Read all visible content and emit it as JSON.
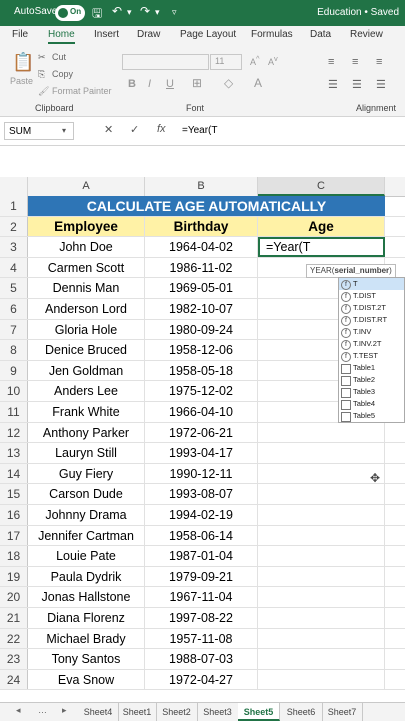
{
  "titlebar": {
    "autosave": "AutoSave",
    "toggle": "On",
    "doc_status": "Education • Saved"
  },
  "tabs": [
    "File",
    "Home",
    "Insert",
    "Draw",
    "Page Layout",
    "Formulas",
    "Data",
    "Review"
  ],
  "ribbon": {
    "paste": "Paste",
    "cut": "Cut",
    "copy": "Copy",
    "format_painter": "Format Painter",
    "clipboard": "Clipboard",
    "font_size": "11",
    "bold": "B",
    "italic": "I",
    "underline": "U",
    "font": "Font",
    "alignment": "Alignment"
  },
  "formula_bar": {
    "name_box": "SUM",
    "cancel": "✕",
    "enter": "✓",
    "fx": "fx",
    "content": "=Year(T"
  },
  "columns": [
    "A",
    "B",
    "C"
  ],
  "title_banner": "CALCULATE AGE AUTOMATICALLY",
  "headers": {
    "employee": "Employee",
    "birthday": "Birthday",
    "age": "Age"
  },
  "active_cell": "=Year(T",
  "rows": [
    {
      "n": "3",
      "name": "John Doe",
      "bday": "1964-04-02"
    },
    {
      "n": "4",
      "name": "Carmen Scott",
      "bday": "1986-11-02"
    },
    {
      "n": "5",
      "name": "Dennis Man",
      "bday": "1969-05-01"
    },
    {
      "n": "6",
      "name": "Anderson Lord",
      "bday": "1982-10-07"
    },
    {
      "n": "7",
      "name": "Gloria Hole",
      "bday": "1980-09-24"
    },
    {
      "n": "8",
      "name": "Denice Bruced",
      "bday": "1958-12-06"
    },
    {
      "n": "9",
      "name": "Jen Goldman",
      "bday": "1958-05-18"
    },
    {
      "n": "10",
      "name": "Anders Lee",
      "bday": "1975-12-02"
    },
    {
      "n": "11",
      "name": "Frank White",
      "bday": "1966-04-10"
    },
    {
      "n": "12",
      "name": "Anthony Parker",
      "bday": "1972-06-21"
    },
    {
      "n": "13",
      "name": "Lauryn Still",
      "bday": "1993-04-17"
    },
    {
      "n": "14",
      "name": "Guy Fiery",
      "bday": "1990-12-11"
    },
    {
      "n": "15",
      "name": "Carson Dude",
      "bday": "1993-08-07"
    },
    {
      "n": "16",
      "name": "Johnny Drama",
      "bday": "1994-02-19"
    },
    {
      "n": "17",
      "name": "Jennifer Cartman",
      "bday": "1958-06-14"
    },
    {
      "n": "18",
      "name": "Louie Pate",
      "bday": "1987-01-04"
    },
    {
      "n": "19",
      "name": "Paula Dydrik",
      "bday": "1979-09-21"
    },
    {
      "n": "20",
      "name": "Jonas Hallstone",
      "bday": "1967-11-04"
    },
    {
      "n": "21",
      "name": "Diana Florenz",
      "bday": "1997-08-22"
    },
    {
      "n": "22",
      "name": "Michael Brady",
      "bday": "1957-11-08"
    },
    {
      "n": "23",
      "name": "Tony Santos",
      "bday": "1988-07-03"
    },
    {
      "n": "24",
      "name": "Eva Snow",
      "bday": "1972-04-27"
    }
  ],
  "tooltip": {
    "prefix": "YEAR(",
    "arg": "serial_number",
    "suffix": ")"
  },
  "autocomplete": [
    {
      "label": "T",
      "kind": "fn"
    },
    {
      "label": "T.DIST",
      "kind": "fn"
    },
    {
      "label": "T.DIST.2T",
      "kind": "fn"
    },
    {
      "label": "T.DIST.RT",
      "kind": "fn"
    },
    {
      "label": "T.INV",
      "kind": "fn"
    },
    {
      "label": "T.INV.2T",
      "kind": "fn"
    },
    {
      "label": "T.TEST",
      "kind": "fn"
    },
    {
      "label": "Table1",
      "kind": "table"
    },
    {
      "label": "Table2",
      "kind": "table"
    },
    {
      "label": "Table3",
      "kind": "table"
    },
    {
      "label": "Table4",
      "kind": "table"
    },
    {
      "label": "Table5",
      "kind": "table"
    }
  ],
  "sheets": [
    "Sheet4",
    "Sheet1",
    "Sheet2",
    "Sheet3",
    "Sheet5",
    "Sheet6",
    "Sheet7"
  ],
  "active_sheet": "Sheet5"
}
